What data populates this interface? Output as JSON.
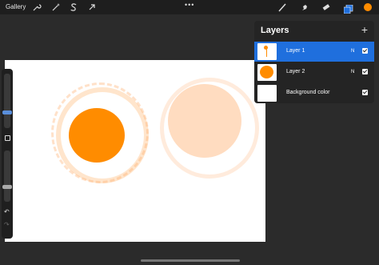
{
  "topbar": {
    "gallery_label": "Gallery",
    "left_tools": [
      "wrench-icon",
      "magic-wand-icon",
      "selection-s-icon",
      "arrow-transform-icon"
    ],
    "more_label": "•••",
    "right_tools": [
      "brush-icon",
      "smudge-icon",
      "eraser-icon",
      "layers-icon"
    ],
    "active_color": "#ff8c00"
  },
  "layers_panel": {
    "title": "Layers",
    "add_label": "+",
    "items": [
      {
        "name": "Layer 1",
        "mode": "N",
        "visible": true,
        "active": true
      },
      {
        "name": "Layer 2",
        "mode": "N",
        "visible": true,
        "active": false
      },
      {
        "name": "Background color",
        "mode": "",
        "visible": true,
        "active": false
      }
    ]
  },
  "colors": {
    "accent": "#1f6fdd",
    "orange": "#ff8c00",
    "peach": "#ffdcc0"
  }
}
